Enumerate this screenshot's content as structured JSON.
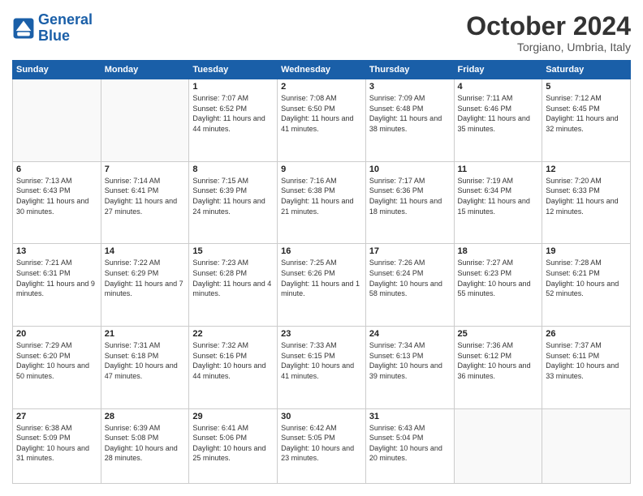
{
  "logo": {
    "line1": "General",
    "line2": "Blue"
  },
  "title": "October 2024",
  "location": "Torgiano, Umbria, Italy",
  "weekdays": [
    "Sunday",
    "Monday",
    "Tuesday",
    "Wednesday",
    "Thursday",
    "Friday",
    "Saturday"
  ],
  "weeks": [
    [
      {
        "day": "",
        "info": ""
      },
      {
        "day": "",
        "info": ""
      },
      {
        "day": "1",
        "info": "Sunrise: 7:07 AM\nSunset: 6:52 PM\nDaylight: 11 hours and 44 minutes."
      },
      {
        "day": "2",
        "info": "Sunrise: 7:08 AM\nSunset: 6:50 PM\nDaylight: 11 hours and 41 minutes."
      },
      {
        "day": "3",
        "info": "Sunrise: 7:09 AM\nSunset: 6:48 PM\nDaylight: 11 hours and 38 minutes."
      },
      {
        "day": "4",
        "info": "Sunrise: 7:11 AM\nSunset: 6:46 PM\nDaylight: 11 hours and 35 minutes."
      },
      {
        "day": "5",
        "info": "Sunrise: 7:12 AM\nSunset: 6:45 PM\nDaylight: 11 hours and 32 minutes."
      }
    ],
    [
      {
        "day": "6",
        "info": "Sunrise: 7:13 AM\nSunset: 6:43 PM\nDaylight: 11 hours and 30 minutes."
      },
      {
        "day": "7",
        "info": "Sunrise: 7:14 AM\nSunset: 6:41 PM\nDaylight: 11 hours and 27 minutes."
      },
      {
        "day": "8",
        "info": "Sunrise: 7:15 AM\nSunset: 6:39 PM\nDaylight: 11 hours and 24 minutes."
      },
      {
        "day": "9",
        "info": "Sunrise: 7:16 AM\nSunset: 6:38 PM\nDaylight: 11 hours and 21 minutes."
      },
      {
        "day": "10",
        "info": "Sunrise: 7:17 AM\nSunset: 6:36 PM\nDaylight: 11 hours and 18 minutes."
      },
      {
        "day": "11",
        "info": "Sunrise: 7:19 AM\nSunset: 6:34 PM\nDaylight: 11 hours and 15 minutes."
      },
      {
        "day": "12",
        "info": "Sunrise: 7:20 AM\nSunset: 6:33 PM\nDaylight: 11 hours and 12 minutes."
      }
    ],
    [
      {
        "day": "13",
        "info": "Sunrise: 7:21 AM\nSunset: 6:31 PM\nDaylight: 11 hours and 9 minutes."
      },
      {
        "day": "14",
        "info": "Sunrise: 7:22 AM\nSunset: 6:29 PM\nDaylight: 11 hours and 7 minutes."
      },
      {
        "day": "15",
        "info": "Sunrise: 7:23 AM\nSunset: 6:28 PM\nDaylight: 11 hours and 4 minutes."
      },
      {
        "day": "16",
        "info": "Sunrise: 7:25 AM\nSunset: 6:26 PM\nDaylight: 11 hours and 1 minute."
      },
      {
        "day": "17",
        "info": "Sunrise: 7:26 AM\nSunset: 6:24 PM\nDaylight: 10 hours and 58 minutes."
      },
      {
        "day": "18",
        "info": "Sunrise: 7:27 AM\nSunset: 6:23 PM\nDaylight: 10 hours and 55 minutes."
      },
      {
        "day": "19",
        "info": "Sunrise: 7:28 AM\nSunset: 6:21 PM\nDaylight: 10 hours and 52 minutes."
      }
    ],
    [
      {
        "day": "20",
        "info": "Sunrise: 7:29 AM\nSunset: 6:20 PM\nDaylight: 10 hours and 50 minutes."
      },
      {
        "day": "21",
        "info": "Sunrise: 7:31 AM\nSunset: 6:18 PM\nDaylight: 10 hours and 47 minutes."
      },
      {
        "day": "22",
        "info": "Sunrise: 7:32 AM\nSunset: 6:16 PM\nDaylight: 10 hours and 44 minutes."
      },
      {
        "day": "23",
        "info": "Sunrise: 7:33 AM\nSunset: 6:15 PM\nDaylight: 10 hours and 41 minutes."
      },
      {
        "day": "24",
        "info": "Sunrise: 7:34 AM\nSunset: 6:13 PM\nDaylight: 10 hours and 39 minutes."
      },
      {
        "day": "25",
        "info": "Sunrise: 7:36 AM\nSunset: 6:12 PM\nDaylight: 10 hours and 36 minutes."
      },
      {
        "day": "26",
        "info": "Sunrise: 7:37 AM\nSunset: 6:11 PM\nDaylight: 10 hours and 33 minutes."
      }
    ],
    [
      {
        "day": "27",
        "info": "Sunrise: 6:38 AM\nSunset: 5:09 PM\nDaylight: 10 hours and 31 minutes."
      },
      {
        "day": "28",
        "info": "Sunrise: 6:39 AM\nSunset: 5:08 PM\nDaylight: 10 hours and 28 minutes."
      },
      {
        "day": "29",
        "info": "Sunrise: 6:41 AM\nSunset: 5:06 PM\nDaylight: 10 hours and 25 minutes."
      },
      {
        "day": "30",
        "info": "Sunrise: 6:42 AM\nSunset: 5:05 PM\nDaylight: 10 hours and 23 minutes."
      },
      {
        "day": "31",
        "info": "Sunrise: 6:43 AM\nSunset: 5:04 PM\nDaylight: 10 hours and 20 minutes."
      },
      {
        "day": "",
        "info": ""
      },
      {
        "day": "",
        "info": ""
      }
    ]
  ]
}
